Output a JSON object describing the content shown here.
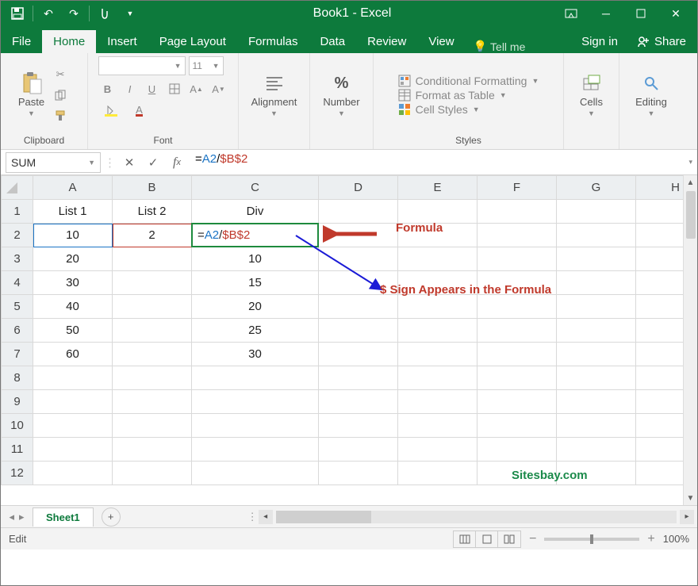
{
  "title": "Book1 - Excel",
  "tabs": {
    "file": "File",
    "home": "Home",
    "insert": "Insert",
    "page_layout": "Page Layout",
    "formulas": "Formulas",
    "data": "Data",
    "review": "Review",
    "view": "View"
  },
  "tellme": "Tell me",
  "signin": "Sign in",
  "share": "Share",
  "ribbon": {
    "clipboard": {
      "paste": "Paste",
      "label": "Clipboard"
    },
    "font": {
      "name": "",
      "size": "11",
      "label": "Font"
    },
    "alignment": "Alignment",
    "number": "Number",
    "styles": {
      "cond": "Conditional Formatting",
      "table": "Format as Table",
      "cell": "Cell Styles",
      "label": "Styles"
    },
    "cells": "Cells",
    "editing": "Editing"
  },
  "namebox": "SUM",
  "formula": {
    "prefix": "=",
    "refA": "A2",
    "op": "/",
    "refB": "$B$2"
  },
  "columns": [
    "A",
    "B",
    "C",
    "D",
    "E",
    "F",
    "G",
    "H"
  ],
  "rows": [
    {
      "n": "1",
      "A": "List 1",
      "B": "List 2",
      "C": "Div"
    },
    {
      "n": "2",
      "A": "10",
      "B": "2",
      "C": "=A2/$B$2"
    },
    {
      "n": "3",
      "A": "20",
      "B": "",
      "C": "10"
    },
    {
      "n": "4",
      "A": "30",
      "B": "",
      "C": "15"
    },
    {
      "n": "5",
      "A": "40",
      "B": "",
      "C": "20"
    },
    {
      "n": "6",
      "A": "50",
      "B": "",
      "C": "25"
    },
    {
      "n": "7",
      "A": "60",
      "B": "",
      "C": "30"
    },
    {
      "n": "8"
    },
    {
      "n": "9"
    },
    {
      "n": "10"
    },
    {
      "n": "11"
    },
    {
      "n": "12"
    }
  ],
  "annot": {
    "formula": "Formula",
    "dollar": "$ Sign Appears in the Formula",
    "credits": "Sitesbay.com"
  },
  "sheet_tab": "Sheet1",
  "status": {
    "mode": "Edit",
    "zoom": "100%"
  }
}
